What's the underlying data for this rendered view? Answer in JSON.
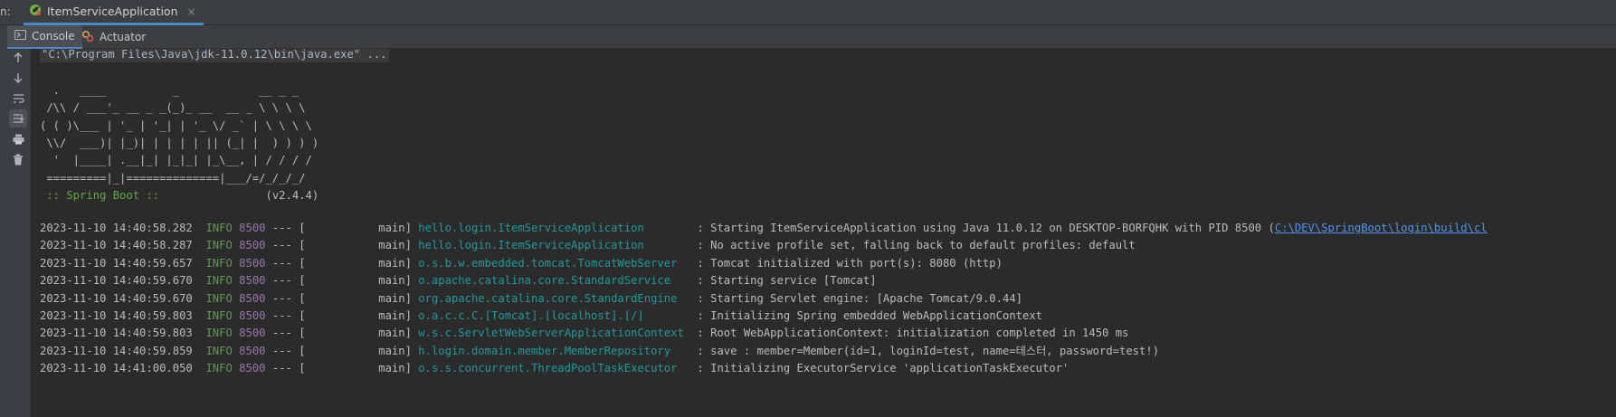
{
  "run_panel": {
    "prefix": "n:",
    "tab_label": "ItemServiceApplication",
    "tab_icon": "spring-leaf-icon",
    "close_glyph": "×"
  },
  "sub_tabs": [
    {
      "label": "Console",
      "icon": "console-icon",
      "active": true
    },
    {
      "label": "Actuator",
      "icon": "actuator-icon",
      "active": false
    }
  ],
  "toolbar": [
    "up-arrow-icon",
    "down-arrow-icon",
    "soft-wrap-icon",
    "scroll-to-end-icon",
    "print-icon",
    "trash-icon"
  ],
  "console": {
    "command": "\"C:\\Program Files\\Java\\jdk-11.0.12\\bin\\java.exe\" ...",
    "banner_lines": [
      "  .   ____          _            __ _ _",
      " /\\\\ / ___'_ __ _ _(_)_ __  __ _ \\ \\ \\ \\",
      "( ( )\\___ | '_ | '_| | '_ \\/ _` | \\ \\ \\ \\",
      " \\\\/  ___)| |_)| | | | | || (_| |  ) ) ) )",
      "  '  |____| .__|_| |_|_| |_\\__, | / / / /",
      " =========|_|==============|___/=/_/_/_/"
    ],
    "boot_label": " :: Spring Boot :: ",
    "boot_version": "               (v2.4.4)",
    "log_lines": [
      {
        "ts": "2023-11-10 14:40:58.282",
        "level": "INFO",
        "pid": "8500",
        "thread": " --- [           main] ",
        "logger": "hello.login.ItemServiceApplication       ",
        "message": " : Starting ItemServiceApplication using Java 11.0.12 on DESKTOP-BORFQHK with PID 8500 (",
        "link": "C:\\DEV\\SpringBoot\\login\\build\\cl"
      },
      {
        "ts": "2023-11-10 14:40:58.287",
        "level": "INFO",
        "pid": "8500",
        "thread": " --- [           main] ",
        "logger": "hello.login.ItemServiceApplication       ",
        "message": " : No active profile set, falling back to default profiles: default",
        "link": ""
      },
      {
        "ts": "2023-11-10 14:40:59.657",
        "level": "INFO",
        "pid": "8500",
        "thread": " --- [           main] ",
        "logger": "o.s.b.w.embedded.tomcat.TomcatWebServer  ",
        "message": " : Tomcat initialized with port(s): 8080 (http)",
        "link": ""
      },
      {
        "ts": "2023-11-10 14:40:59.670",
        "level": "INFO",
        "pid": "8500",
        "thread": " --- [           main] ",
        "logger": "o.apache.catalina.core.StandardService   ",
        "message": " : Starting service [Tomcat]",
        "link": ""
      },
      {
        "ts": "2023-11-10 14:40:59.670",
        "level": "INFO",
        "pid": "8500",
        "thread": " --- [           main] ",
        "logger": "org.apache.catalina.core.StandardEngine  ",
        "message": " : Starting Servlet engine: [Apache Tomcat/9.0.44]",
        "link": ""
      },
      {
        "ts": "2023-11-10 14:40:59.803",
        "level": "INFO",
        "pid": "8500",
        "thread": " --- [           main] ",
        "logger": "o.a.c.c.C.[Tomcat].[localhost].[/]       ",
        "message": " : Initializing Spring embedded WebApplicationContext",
        "link": ""
      },
      {
        "ts": "2023-11-10 14:40:59.803",
        "level": "INFO",
        "pid": "8500",
        "thread": " --- [           main] ",
        "logger": "w.s.c.ServletWebServerApplicationContext ",
        "message": " : Root WebApplicationContext: initialization completed in 1450 ms",
        "link": ""
      },
      {
        "ts": "2023-11-10 14:40:59.859",
        "level": "INFO",
        "pid": "8500",
        "thread": " --- [           main] ",
        "logger": "h.login.domain.member.MemberRepository   ",
        "message": " : save : member=Member(id=1, loginId=test, name=테스터, password=test!)",
        "link": ""
      },
      {
        "ts": "2023-11-10 14:41:00.050",
        "level": "INFO",
        "pid": "8500",
        "thread": " --- [           main] ",
        "logger": "o.s.s.concurrent.ThreadPoolTaskExecutor  ",
        "message": " : Initializing ExecutorService 'applicationTaskExecutor'",
        "link": ""
      }
    ]
  }
}
